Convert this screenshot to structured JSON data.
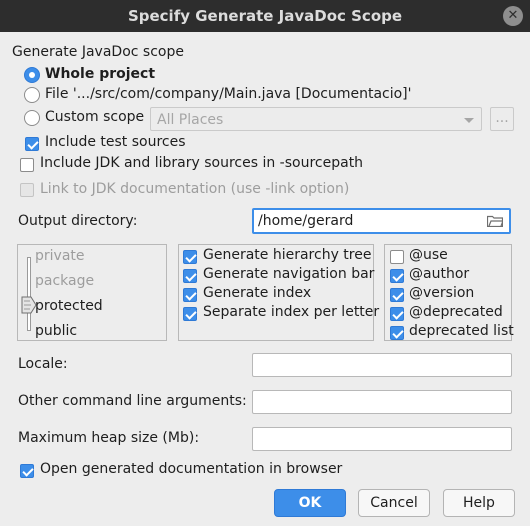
{
  "window": {
    "title": "Specify Generate JavaDoc Scope"
  },
  "scope": {
    "group_label": "Generate JavaDoc scope",
    "whole_project": "Whole project",
    "file": "File '.../src/com/company/Main.java [Documentacio]'",
    "custom_scope": "Custom scope",
    "custom_scope_value": "All Places",
    "ellipsis": "...",
    "include_test_sources": "Include test sources",
    "selected": "Whole project"
  },
  "options": {
    "include_jdk": "Include JDK and library sources in -sourcepath",
    "link_jdk": "Link to JDK documentation (use -link option)"
  },
  "output": {
    "label": "Output directory:",
    "value": "/home/gerard"
  },
  "visibility": {
    "levels": [
      "private",
      "package",
      "protected",
      "public"
    ],
    "selected": "protected"
  },
  "generate": {
    "hierarchy": "Generate hierarchy tree",
    "navigation": "Generate navigation bar",
    "index": "Generate index",
    "separate_index": "Separate index per letter"
  },
  "tags": {
    "use": "@use",
    "author": "@author",
    "version": "@version",
    "deprecated": "@deprecated",
    "deprecated_list": "deprecated list"
  },
  "fields": {
    "locale": "Locale:",
    "other_args": "Other command line arguments:",
    "max_heap": "Maximum heap size (Mb):"
  },
  "open_browser": "Open generated documentation in browser",
  "buttons": {
    "ok": "OK",
    "cancel": "Cancel",
    "help": "Help"
  },
  "colors": {
    "accent": "#3d8ee9",
    "titlebar": "#2d2d2d",
    "background": "#ededed"
  }
}
